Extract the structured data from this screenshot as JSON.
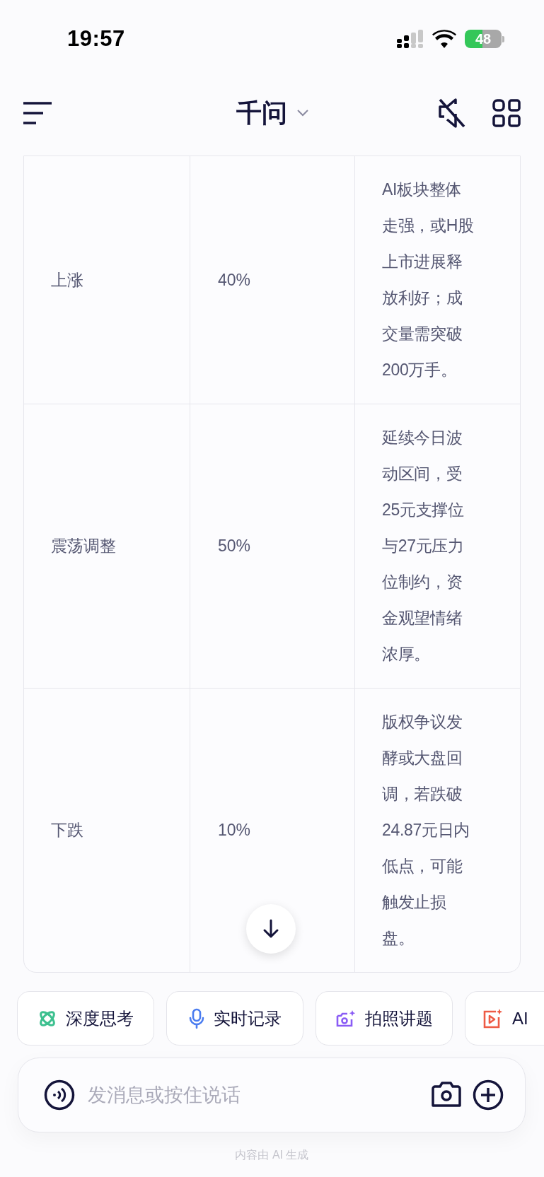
{
  "status_bar": {
    "time": "19:57",
    "battery": "48"
  },
  "header": {
    "title": "千问"
  },
  "table": {
    "rows": [
      {
        "cells": [
          "上涨",
          "40%",
          "AI板块整体走强，或H股上市进展释放利好；成交量需突破200万手。"
        ]
      },
      {
        "cells": [
          "震荡调整",
          "50%",
          "延续今日波动区间，受25元支撑位与27元压力位制约，资金观望情绪浓厚。"
        ]
      },
      {
        "cells": [
          "下跌",
          "10%",
          "版权争议发酵或大盘回调，若跌破24.87元日内低点，可能触发止损盘。"
        ]
      }
    ]
  },
  "chips": [
    {
      "kind": "atom",
      "label": "深度思考"
    },
    {
      "kind": "mic",
      "label": "实时记录"
    },
    {
      "kind": "camera",
      "label": "拍照讲题"
    },
    {
      "kind": "video",
      "label": "AI"
    }
  ],
  "input": {
    "placeholder": "发消息或按住说话"
  },
  "footer_note": "内容由 AI 生成"
}
